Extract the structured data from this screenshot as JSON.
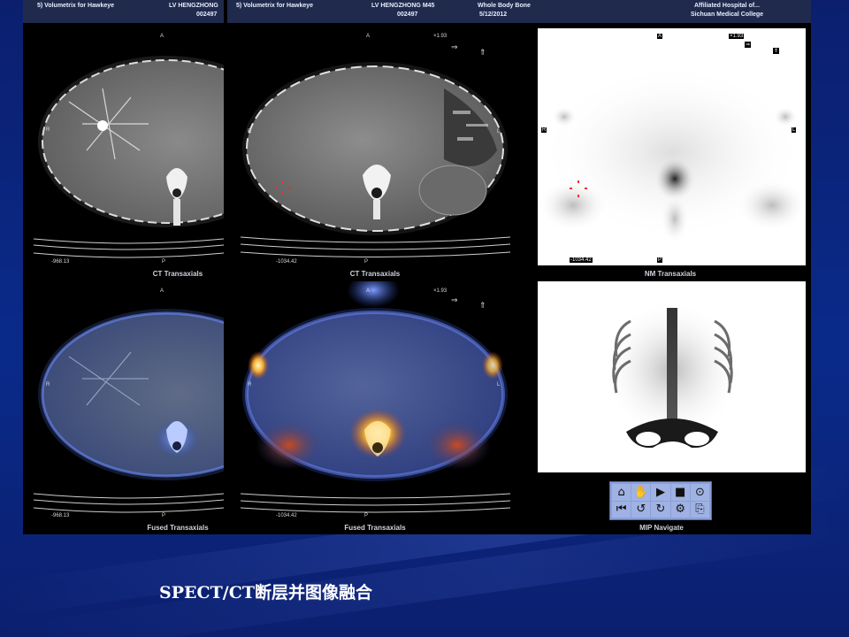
{
  "slide_title": "SPECT/CT断层并图像融合",
  "headers": {
    "left": {
      "software": "5) Volumetrix for Hawkeye",
      "patient": "LV HENGZHONG",
      "id": "002497"
    },
    "middle": {
      "software": "5) Volumetrix for Hawkeye",
      "patient": "LV HENGZHONG M45",
      "id": "002497",
      "study": "Whole Body Bone",
      "date": "5/12/2012"
    },
    "right": {
      "institution_line1": "Affiliated Hospital of...",
      "institution_line2": "Sichuan Medical College"
    }
  },
  "viewports": {
    "ct_left": {
      "caption": "CT Transaxials",
      "top_marker": "A",
      "bottom_marker": "P",
      "right_marker": "R",
      "value": "-968.13"
    },
    "ct_main": {
      "caption": "CT Transaxials",
      "top_marker": "A",
      "bottom_marker": "P",
      "left_marker": "R",
      "right_marker": "L",
      "value": "-1034.42",
      "zoom": "×1.93"
    },
    "nm": {
      "caption": "NM Transaxials",
      "top_marker": "A",
      "bottom_marker": "P",
      "left_marker": "R",
      "right_marker": "L",
      "value": "-1034.42",
      "zoom": "×1.93"
    },
    "fused_left": {
      "caption": "Fused Transaxials",
      "top_marker": "A",
      "bottom_marker": "P",
      "right_marker": "R",
      "value": "-968.13"
    },
    "fused_main": {
      "caption": "Fused Transaxials",
      "top_marker": "A",
      "bottom_marker": "P",
      "left_marker": "R",
      "right_marker": "L",
      "value": "-1034.42",
      "zoom": "×1.93"
    },
    "mip": {
      "caption": "MIP Navigate"
    }
  },
  "nav_icons": [
    "home-icon",
    "hand-icon",
    "play-icon",
    "stop-icon",
    "target-icon",
    "skip-back-icon",
    "rotate-left-icon",
    "rotate-right-icon",
    "settings-icon",
    "export-icon"
  ],
  "nav_glyphs": [
    "⌂",
    "✋",
    "▶",
    "■",
    "⊙",
    "⏮",
    "↺",
    "↻",
    "⚙",
    "⎘"
  ],
  "colors": {
    "background": "#0a2a8a",
    "title_bar": "#202a4c",
    "nav_panel": "#8aa0d8"
  }
}
